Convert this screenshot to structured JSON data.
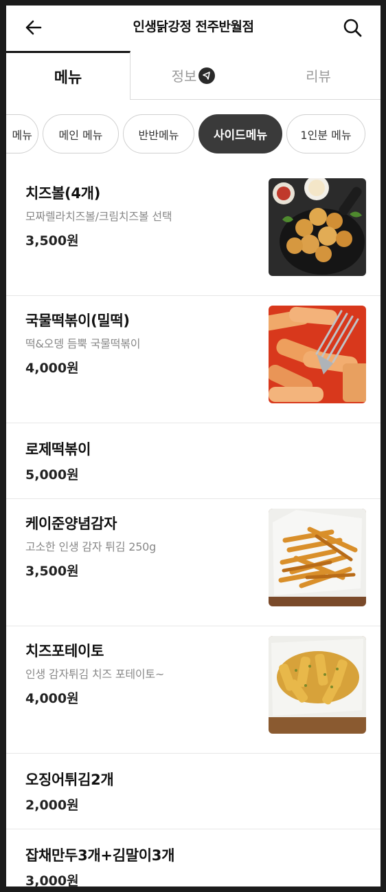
{
  "header": {
    "title": "인생닭강정 전주반월점",
    "back_icon": "arrow-left-icon",
    "search_icon": "search-icon"
  },
  "tabs": [
    {
      "label": "메뉴",
      "active": true
    },
    {
      "label": "정보",
      "active": false,
      "badge_icon": "megaphone-icon"
    },
    {
      "label": "리뷰",
      "active": false
    }
  ],
  "categories": [
    {
      "label": "메뉴",
      "active": false
    },
    {
      "label": "메인 메뉴",
      "active": false
    },
    {
      "label": "반반메뉴",
      "active": false
    },
    {
      "label": "사이드메뉴",
      "active": true
    },
    {
      "label": "1인분 메뉴",
      "active": false
    }
  ],
  "items": [
    {
      "name": "치즈볼(4개)",
      "desc": "모짜렐라치즈볼/크림치즈볼 선택",
      "price": "3,500원",
      "image": "cheese-balls-photo"
    },
    {
      "name": "국물떡볶이(밀떡)",
      "desc": "떡&오뎅 듬뿍 국물떡볶이",
      "price": "4,000원",
      "image": "tteokbokki-photo"
    },
    {
      "name": "로제떡볶이",
      "desc": "",
      "price": "5,000원"
    },
    {
      "name": "케이준양념감자",
      "desc": "고소한 인생 감자 튀김 250g",
      "price": "3,500원",
      "image": "cajun-fries-photo"
    },
    {
      "name": "치즈포테이토",
      "desc": "인생 감자튀김 치즈 포테이토~",
      "price": "4,000원",
      "image": "cheese-fries-photo"
    },
    {
      "name": "오징어튀김2개",
      "desc": "",
      "price": "2,000원"
    },
    {
      "name": "잡채만두3개+김말이3개",
      "desc": "",
      "price": "3,000원"
    }
  ],
  "colors": {
    "accent": "#3a3a3a",
    "text": "#111111",
    "muted": "#888888",
    "divider": "#e6e6e6"
  }
}
